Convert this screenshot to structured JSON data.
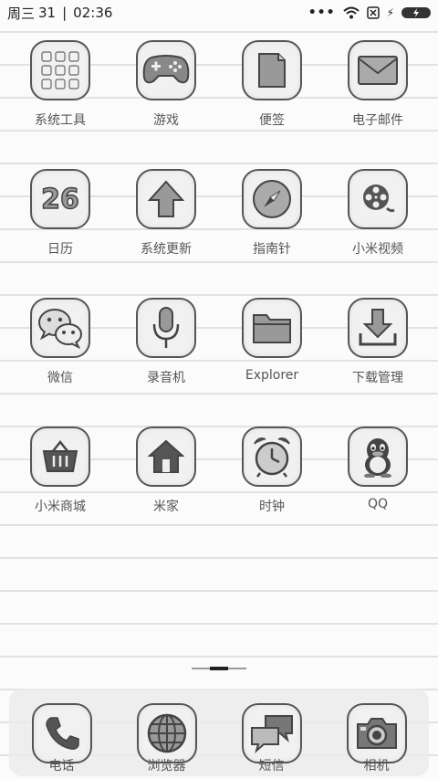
{
  "status_bar": {
    "day": "周三",
    "date": "31",
    "separator": "|",
    "time": "02:36",
    "signal_dots": "•••",
    "battery_symbol": "⚡"
  },
  "apps": [
    {
      "label": "系统工具",
      "icon": "folder-grid-icon"
    },
    {
      "label": "游戏",
      "icon": "gamepad-icon"
    },
    {
      "label": "便签",
      "icon": "note-icon"
    },
    {
      "label": "电子邮件",
      "icon": "envelope-icon"
    },
    {
      "label": "日历",
      "icon": "calendar-icon",
      "icon_text": "26"
    },
    {
      "label": "系统更新",
      "icon": "up-arrow-icon"
    },
    {
      "label": "指南针",
      "icon": "compass-icon"
    },
    {
      "label": "小米视频",
      "icon": "film-reel-icon"
    },
    {
      "label": "微信",
      "icon": "chat-bubbles-icon"
    },
    {
      "label": "录音机",
      "icon": "microphone-icon"
    },
    {
      "label": "Explorer",
      "icon": "folder-icon"
    },
    {
      "label": "下载管理",
      "icon": "download-icon"
    },
    {
      "label": "小米商城",
      "icon": "basket-icon"
    },
    {
      "label": "米家",
      "icon": "home-icon"
    },
    {
      "label": "时钟",
      "icon": "alarm-clock-icon"
    },
    {
      "label": "QQ",
      "icon": "penguin-icon"
    }
  ],
  "dock": [
    {
      "label": "电话",
      "icon": "phone-icon"
    },
    {
      "label": "浏览器",
      "icon": "globe-icon"
    },
    {
      "label": "短信",
      "icon": "message-bubbles-icon"
    },
    {
      "label": "相机",
      "icon": "camera-icon"
    }
  ]
}
